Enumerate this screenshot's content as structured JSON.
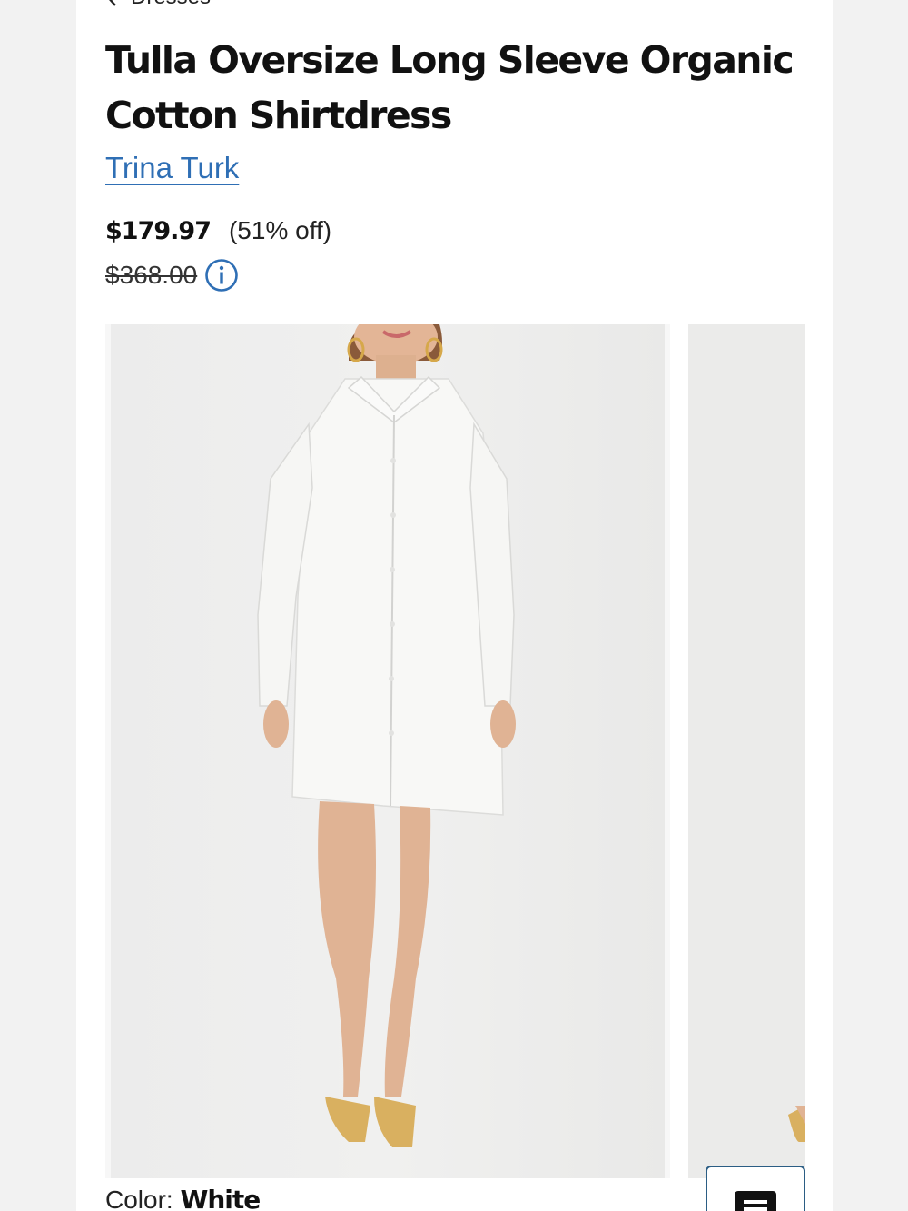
{
  "breadcrumb": {
    "label": "Dresses"
  },
  "product": {
    "title": "Tulla Oversize Long Sleeve Organic Cotton Shirtdress",
    "brand": "Trina Turk",
    "price": "$179.97",
    "discount": "(51% off)",
    "original_price": "$368.00"
  },
  "gallery": {
    "main_image": "product-photo-white-shirtdress",
    "next_image": "product-photo-next"
  },
  "color": {
    "label": "Color:",
    "value": "White"
  },
  "colors": {
    "link": "#2f6fb5",
    "button_border": "#2b5d84"
  }
}
